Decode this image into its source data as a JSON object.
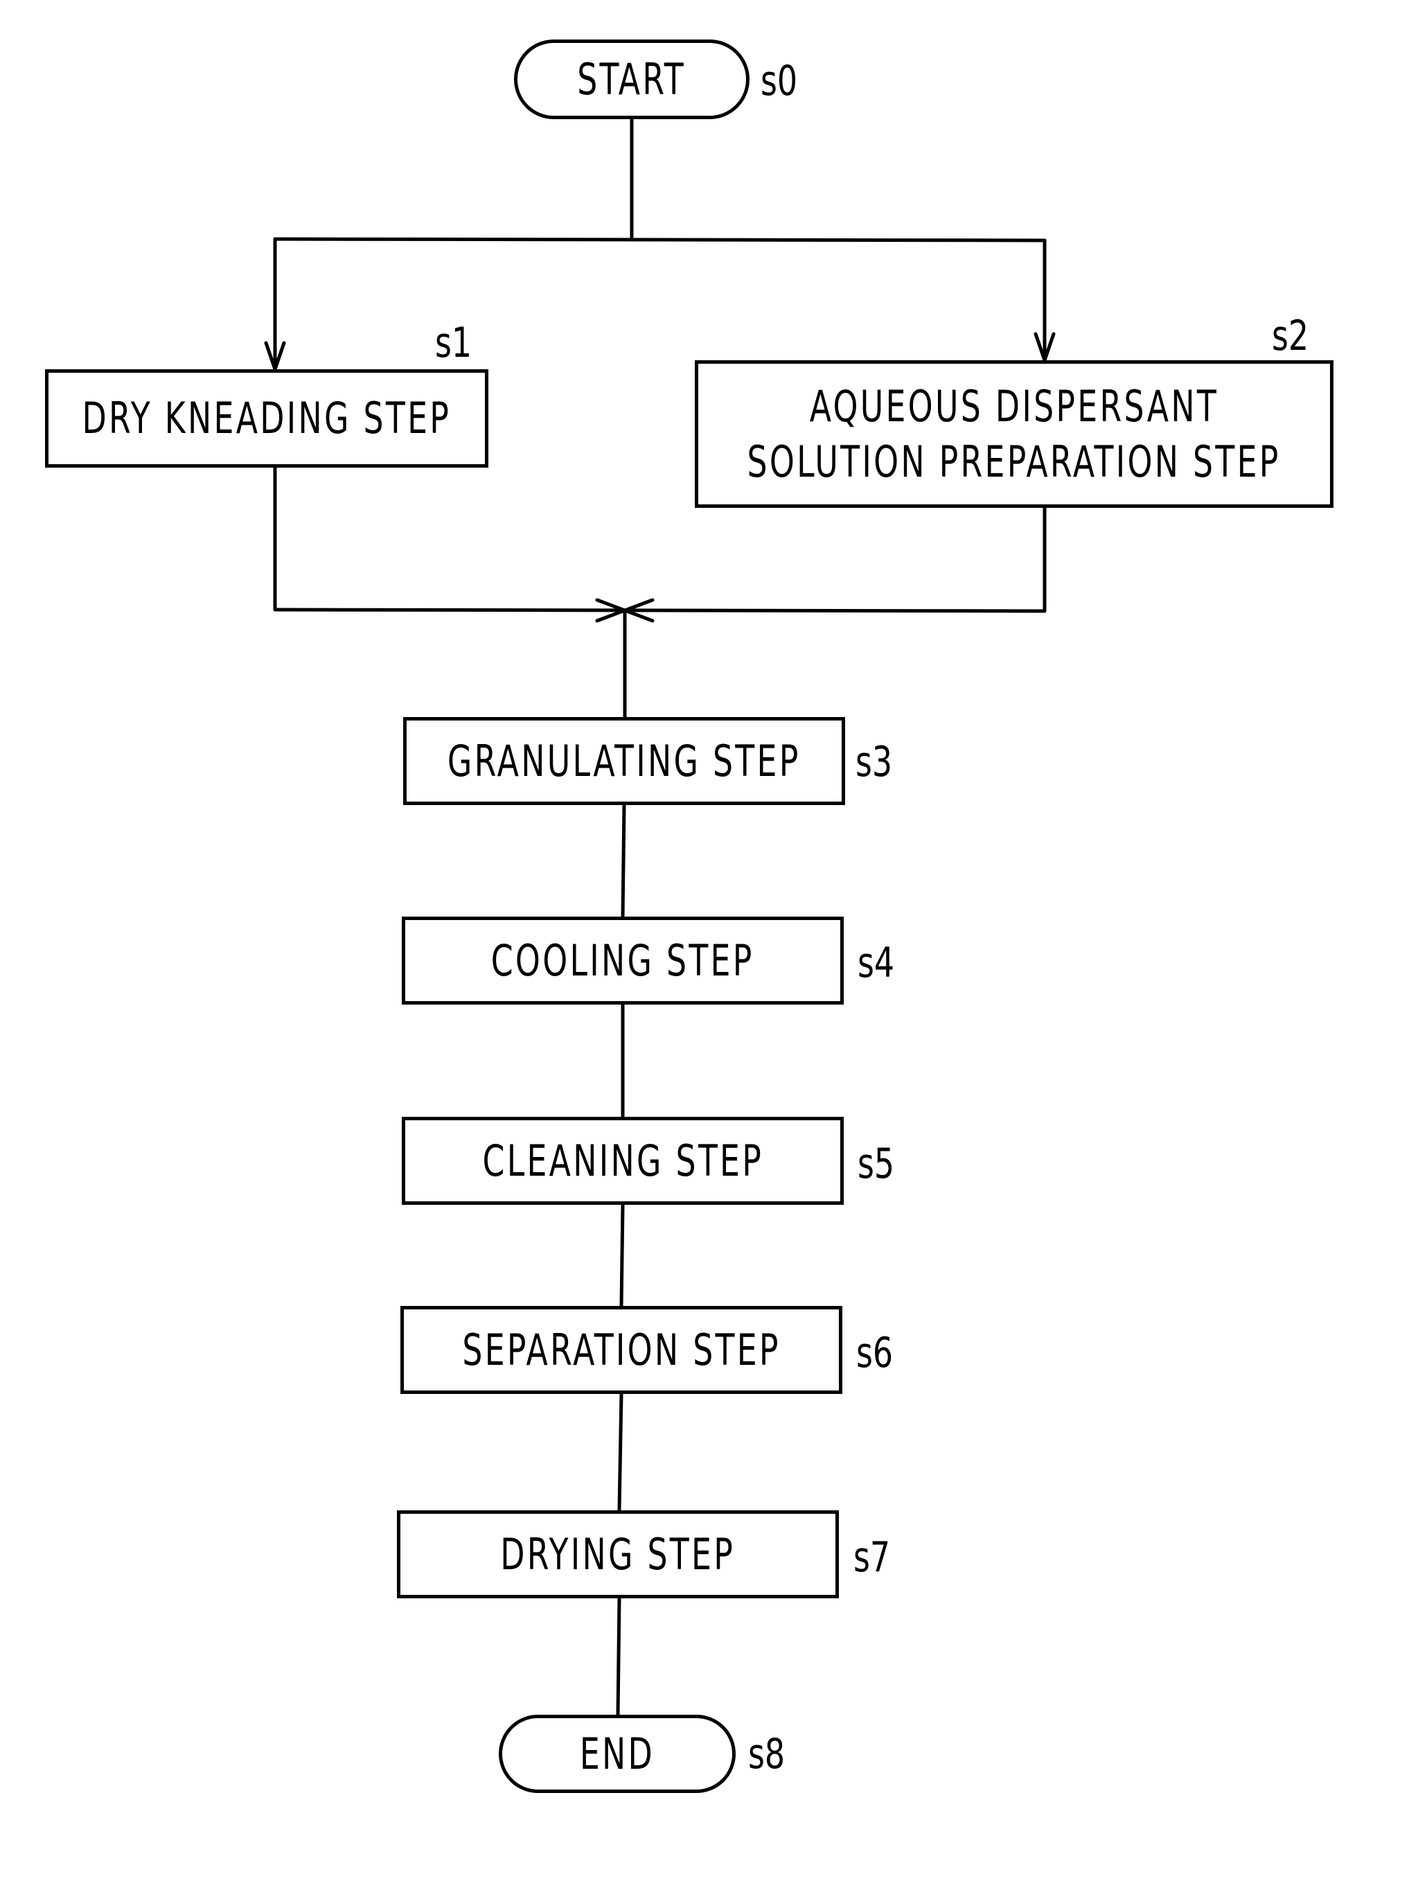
{
  "diagram": {
    "type": "flowchart",
    "nodes": [
      {
        "id": "s0",
        "label": "START",
        "shape": "terminal"
      },
      {
        "id": "s1",
        "label": "DRY KNEADING STEP",
        "shape": "process"
      },
      {
        "id": "s2",
        "label_line1": "AQUEOUS DISPERSANT",
        "label_line2": "SOLUTION PREPARATION STEP",
        "shape": "process"
      },
      {
        "id": "s3",
        "label": "GRANULATING STEP",
        "shape": "process"
      },
      {
        "id": "s4",
        "label": "COOLING STEP",
        "shape": "process"
      },
      {
        "id": "s5",
        "label": "CLEANING STEP",
        "shape": "process"
      },
      {
        "id": "s6",
        "label": "SEPARATION STEP",
        "shape": "process"
      },
      {
        "id": "s7",
        "label": "DRYING STEP",
        "shape": "process"
      },
      {
        "id": "s8",
        "label": "END",
        "shape": "terminal"
      }
    ],
    "edges": [
      [
        "s0",
        "s1"
      ],
      [
        "s0",
        "s2"
      ],
      [
        "s1",
        "s3"
      ],
      [
        "s2",
        "s3"
      ],
      [
        "s3",
        "s4"
      ],
      [
        "s4",
        "s5"
      ],
      [
        "s5",
        "s6"
      ],
      [
        "s6",
        "s7"
      ],
      [
        "s7",
        "s8"
      ]
    ]
  }
}
